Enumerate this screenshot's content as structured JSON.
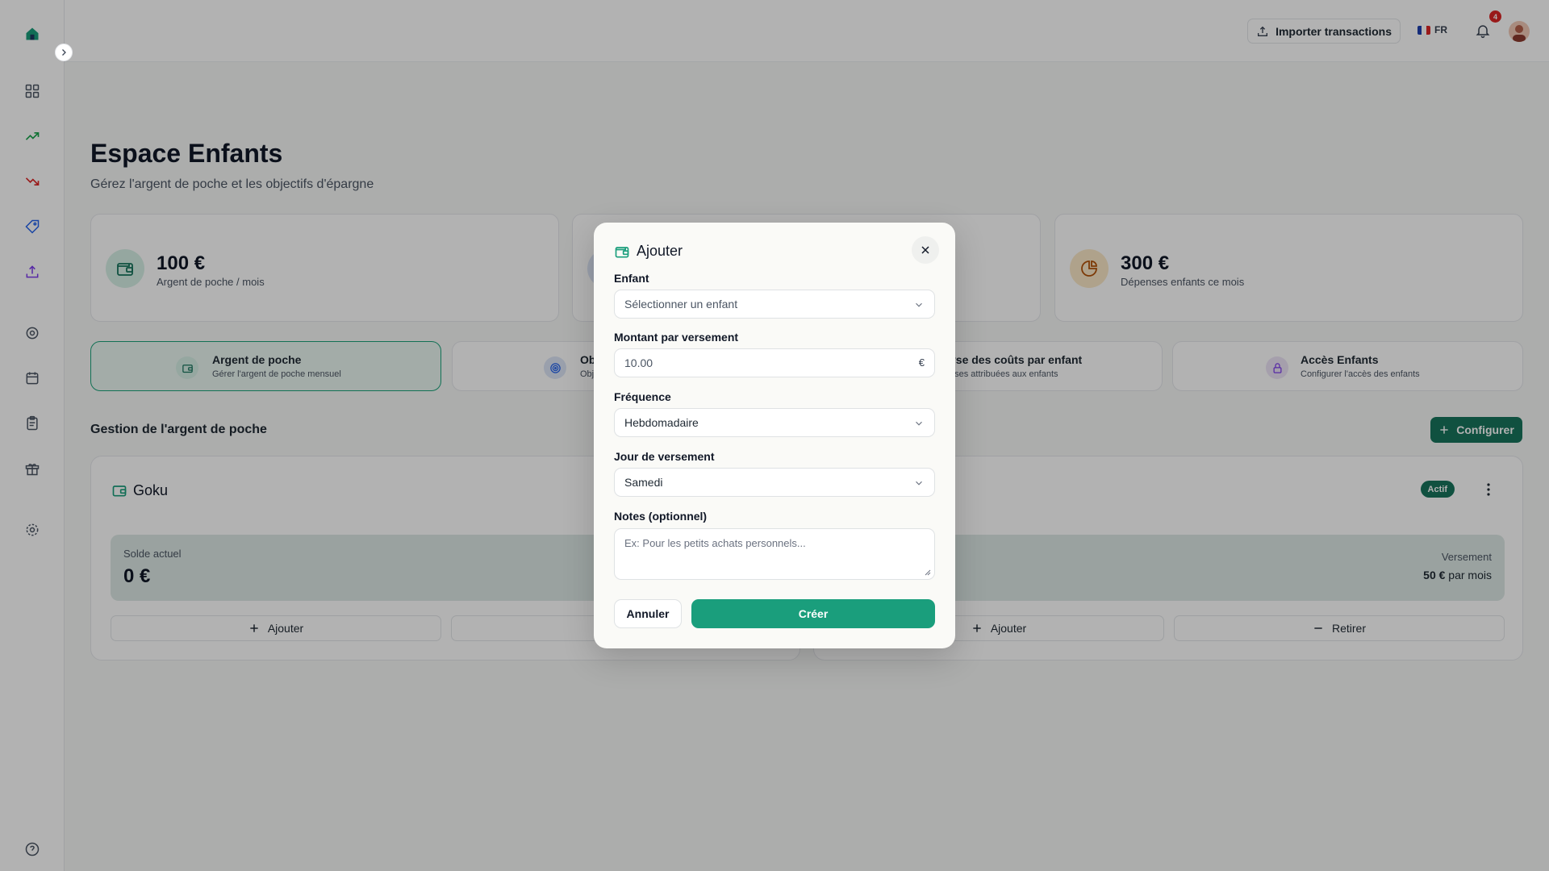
{
  "topbar": {
    "import_label": "Importer transactions",
    "lang": "FR",
    "notif_count": "4"
  },
  "page": {
    "title": "Espace Enfants",
    "subtitle": "Gérez l'argent de poche et les objectifs d'épargne"
  },
  "stats": [
    {
      "value": "100 €",
      "label": "Argent de poche / mois"
    },
    {
      "value": "300 €",
      "label": "Dépenses enfants ce mois"
    }
  ],
  "tabs": [
    {
      "title": "Argent de poche",
      "sub": "Gérer l'argent de poche mensuel"
    },
    {
      "title": "Ob",
      "sub": "Obj"
    },
    {
      "title": "yse des coûts par enfant",
      "sub": "nses attribuées aux enfants"
    },
    {
      "title": "Accès Enfants",
      "sub": "Configurer l'accès des enfants"
    }
  ],
  "section": {
    "title": "Gestion de l'argent de poche",
    "configure_label": "Configurer"
  },
  "child_cards": [
    {
      "name": "Goku",
      "balance_label": "Solde actuel",
      "balance": "0 €",
      "add_label": "Ajouter"
    },
    {
      "status": "Actif",
      "payment_label": "Versement",
      "payment_amount": "50 €",
      "payment_period": " par mois",
      "add_label": "Ajouter",
      "withdraw_label": "Retirer"
    }
  ],
  "modal": {
    "title": "Ajouter",
    "child_label": "Enfant",
    "child_placeholder": "Sélectionner un enfant",
    "amount_label": "Montant par versement",
    "amount_value": "10.00",
    "currency": "€",
    "frequency_label": "Fréquence",
    "frequency_value": "Hebdomadaire",
    "day_label": "Jour de versement",
    "day_value": "Samedi",
    "notes_label": "Notes (optionnel)",
    "notes_placeholder": "Ex: Pour les petits achats personnels...",
    "cancel_label": "Annuler",
    "create_label": "Créer"
  },
  "colors": {
    "accent": "#1a9e7c",
    "accent_dark": "#17745c",
    "badge": "#dc2626"
  }
}
